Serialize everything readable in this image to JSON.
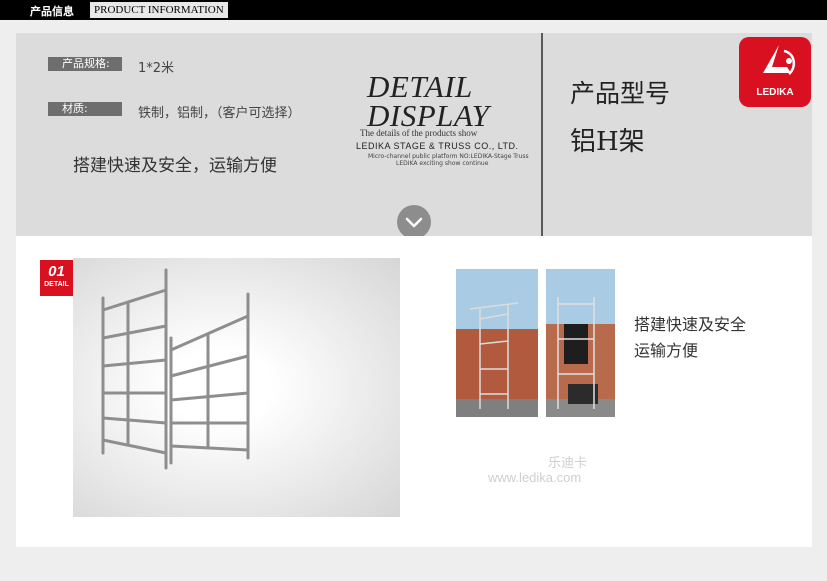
{
  "header": {
    "title_cn": "产品信息",
    "title_en": "PRODUCT INFORMATION"
  },
  "specs": [
    {
      "label": "产品规格:",
      "value": "1*2米"
    },
    {
      "label": "材质:",
      "value": "铁制，铝制，（客户可选择）"
    }
  ],
  "slogan": "搭建快速及安全，运输方便",
  "detail_display": {
    "line1": "DETAIL",
    "line2": "DISPLAY",
    "subtitle": "The details of the products show",
    "company": "LEDIKA STAGE & TRUSS CO., LTD.",
    "tiny1": "Micro-channel public platform NO:LEDIKA-Stage Truss",
    "tiny2": "LEDIKA exciting show continue"
  },
  "model": {
    "label": "产品型号",
    "value": "铝H架"
  },
  "logo": {
    "text": "LEDIKA",
    "color": "#d8101f"
  },
  "badge": {
    "number": "01",
    "word": "DETAIL",
    "color": "#d8101f"
  },
  "features": [
    "搭建快速及安全",
    "运输方便"
  ],
  "watermark": {
    "cn": "乐迪卡",
    "url": "www.ledika.com"
  },
  "icons": {
    "scroll": "chevron-down-icon"
  }
}
